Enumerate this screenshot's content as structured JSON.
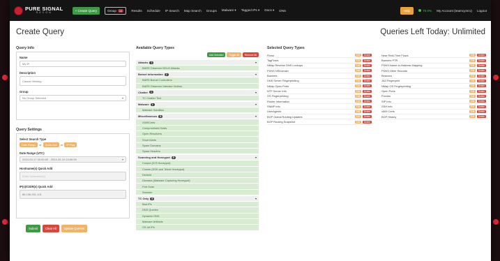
{
  "nav": {
    "logo_line1": "PURE SIGNAL",
    "logo_line2": "RECON",
    "create_query": "+ Create Query",
    "groups_button": "Group",
    "groups_badge": "14",
    "links": [
      "Results",
      "Schedule",
      "IP Search",
      "Map Search",
      "Groups",
      "Malware ▾",
      "Tagged IPs ▾",
      "Docs ▾",
      "DNS"
    ],
    "help": "Help",
    "status": "75.0%",
    "account": "My Account (teamcymru)",
    "logout": "Logout"
  },
  "page": {
    "title": "Create Query",
    "queries_left": "Queries Left Today: Unlimited"
  },
  "query_info": {
    "heading": "Query Info",
    "name_label": "Name",
    "name_value": "My IP",
    "description_label": "Description",
    "description_value": "Casual Viewing",
    "group_label": "Group",
    "group_value": "No Group Selected"
  },
  "query_settings": {
    "heading": "Query Settings",
    "search_type_label": "Select Search Type",
    "search_types": [
      "Date Range",
      "Quick Add",
      "IP Flag"
    ],
    "or_text": "or",
    "date_range_label": "Date Range (UTC)",
    "date_range_value": "2024-03-17 00:00:00 - 2024-03-19 23:59:59",
    "hostname_label": "Hostname(s) Quick Add",
    "hostname_placeholder": "Enter hostname(s)",
    "ip_label": "IP(s)/CIDR(s) Quick Add",
    "ip_value": "86.106.201.101"
  },
  "actions": {
    "submit": "Submit",
    "clear": "Clear All",
    "update": "Update Queries"
  },
  "available": {
    "heading": "Available Query Types",
    "add_selected": "Add Selected",
    "toggle_all": "Toggle All",
    "remove_all": "Remove All",
    "categories": [
      {
        "name": "Attacks",
        "count": "1",
        "items": [
          "BARS Observed DDoS Attacks"
        ]
      },
      {
        "name": "Botnet Information",
        "count": "2",
        "items": [
          "BARS Botnet Controllers",
          "BARS Observed Infected Victims"
        ]
      },
      {
        "name": "Chatter",
        "count": "1",
        "items": [
          "TC Chatter Text"
        ]
      },
      {
        "name": "Malware",
        "count": "1",
        "items": [
          "Malware Sandbox"
        ]
      },
      {
        "name": "Miscellaneous",
        "count": "6",
        "items": [
          "X509Certs",
          "Compromised Hosts",
          "Open Resolvers",
          "Snort Alerts",
          "Spam Domains",
          "Spam Headers"
        ]
      },
      {
        "name": "Scanning and Honeypot",
        "count": "5",
        "items": [
          "Conpot (ICS Honeypot)",
          "Cowrie (SSH and Telnet Honeypot)",
          "Dshield",
          "Dionaea (Malware Capturing Honeypot)",
          "Port Scan",
          "Scanner"
        ]
      },
      {
        "name": "TC Only",
        "count": "5",
        "items": [
          "Bad IPs",
          "DNS Queries",
          "Dynamic DNS",
          "Malware Artifacts",
          "OS Int IPs"
        ]
      }
    ]
  },
  "selected": {
    "heading": "Selected Query Types",
    "tag_edit": "Edit",
    "tag_delete": "Delete",
    "left": [
      "Flows",
      "TagFlows",
      "NMap Reverse DNS Lookups",
      "PDNS NSDomain",
      "Banners",
      "DNS Server Fingerprinting",
      "NMap Open Ports",
      "NTP Server Info",
      "OS Fingerprinting",
      "Router Information",
      "SNMP Info",
      "UserAgents",
      "BGP Global Routing Updates",
      "BGP Routing Snapshot"
    ],
    "right": [
      "Near Real-Time Flows",
      "Banners PTR",
      "PDNS Name-to-Address Mapping",
      "PDNS Other Records",
      "Beacons",
      "JA3 Fingerprint",
      "NMap OS Fingerprinting",
      "Open Ports",
      "Proxies",
      "SIP Info",
      "SSH Info",
      "x509 Certs",
      "BGP History"
    ]
  },
  "colors": {
    "nav_bg": "#141414",
    "brand_red": "#c8202f",
    "success_green": "#3f9a45",
    "warning_orange": "#f0b36a",
    "item_green": "#d7ecd3"
  }
}
